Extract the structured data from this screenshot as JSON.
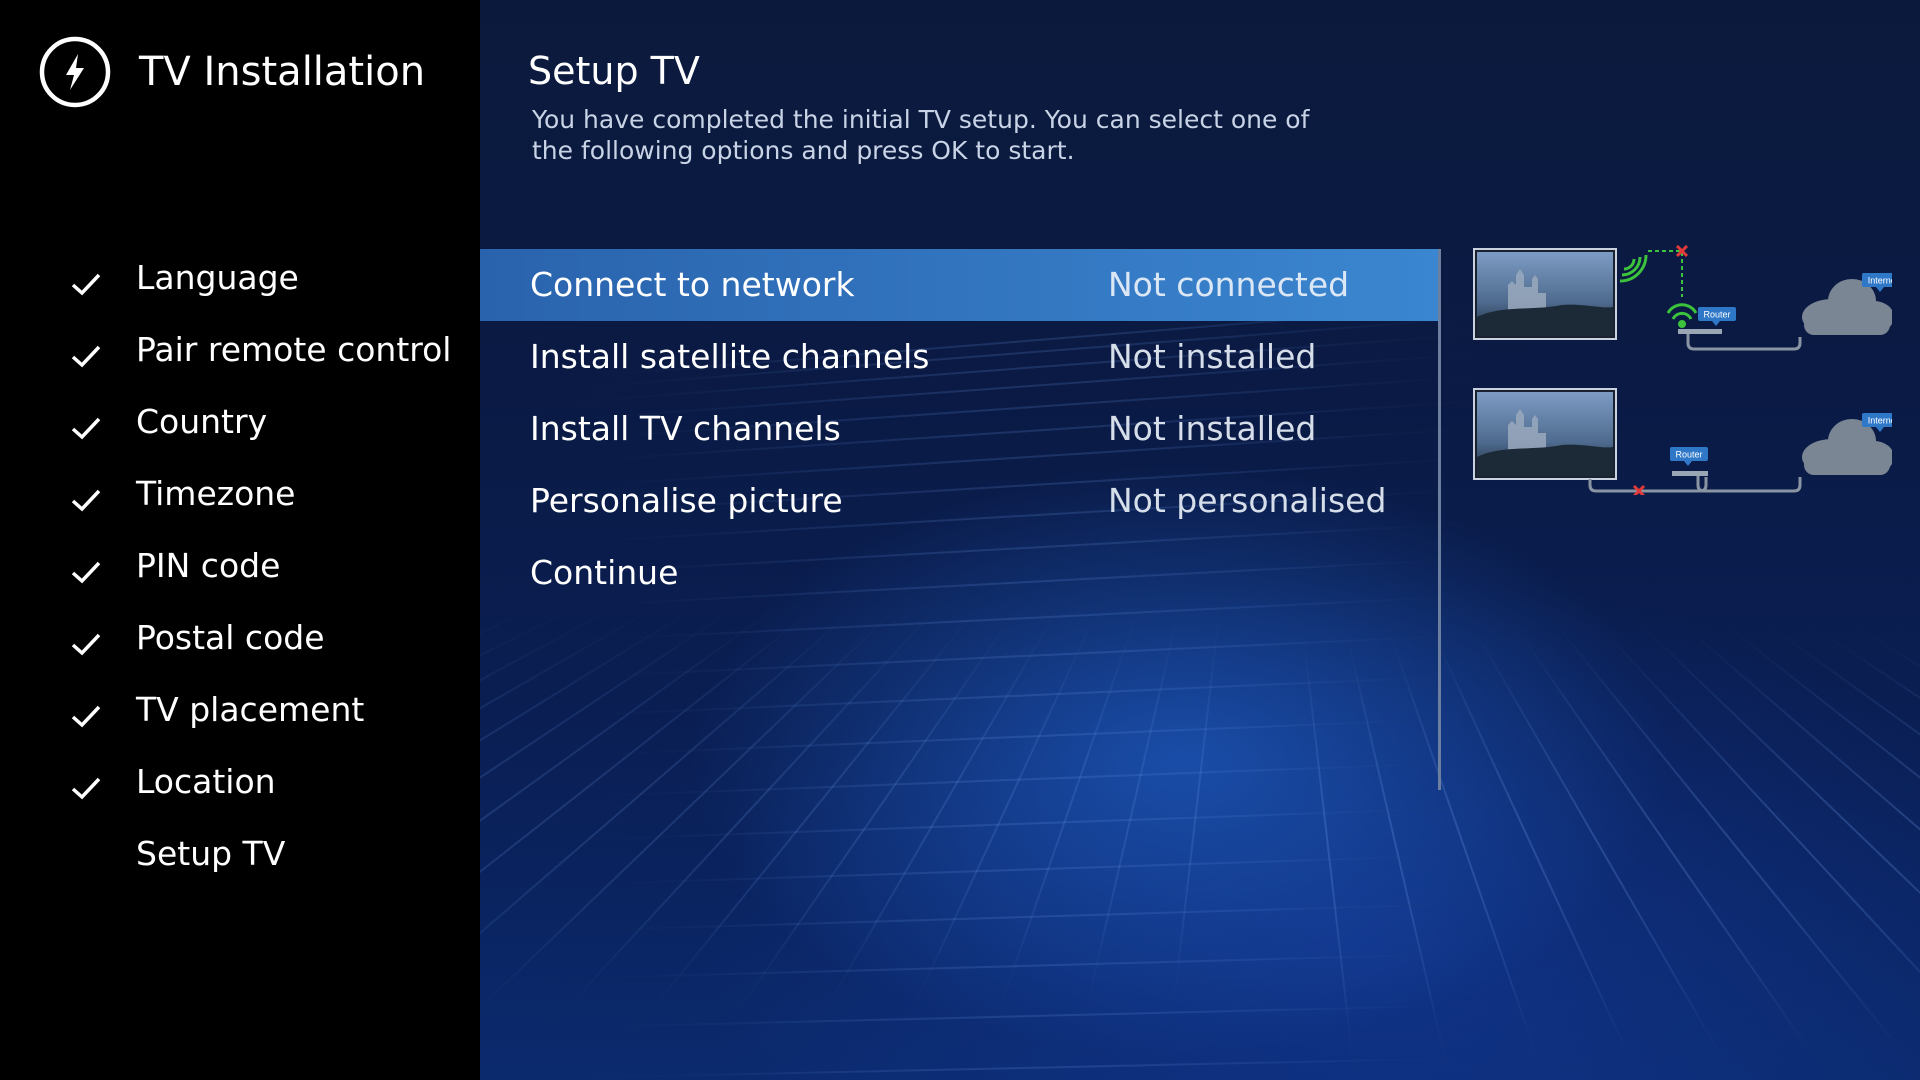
{
  "app": {
    "title": "TV Installation",
    "logo_icon": "power-bolt-icon"
  },
  "sidebar": {
    "steps": [
      {
        "label": "Language",
        "done": true
      },
      {
        "label": "Pair remote control",
        "done": true
      },
      {
        "label": "Country",
        "done": true
      },
      {
        "label": "Timezone",
        "done": true
      },
      {
        "label": "PIN code",
        "done": true
      },
      {
        "label": "Postal code",
        "done": true
      },
      {
        "label": "TV placement",
        "done": true
      },
      {
        "label": "Location",
        "done": true
      },
      {
        "label": "Setup TV",
        "done": false
      }
    ]
  },
  "main": {
    "title": "Setup TV",
    "description": "You have completed the initial TV setup. You can select one of the following options and press OK to start.",
    "options": [
      {
        "label": "Connect to network",
        "status": "Not connected",
        "selected": true
      },
      {
        "label": "Install satellite channels",
        "status": "Not installed",
        "selected": false
      },
      {
        "label": "Install TV channels",
        "status": "Not installed",
        "selected": false
      },
      {
        "label": "Personalise picture",
        "status": "Not personalised",
        "selected": false
      },
      {
        "label": "Continue",
        "status": "",
        "selected": false
      }
    ]
  },
  "diagrams": {
    "router_label": "Router",
    "internet_label": "Internet",
    "wifi_icon": "wifi-icon",
    "error_icon": "red-x-icon",
    "cloud_icon": "cloud-icon"
  },
  "colors": {
    "accent": "#3277c2",
    "sidebar_bg": "#000000",
    "main_bg": "#0a1a44",
    "wifi_green": "#3cc23c",
    "error_red": "#e23a3a",
    "cloud_grey": "#7a8694",
    "tag_blue": "#2f78c8"
  }
}
